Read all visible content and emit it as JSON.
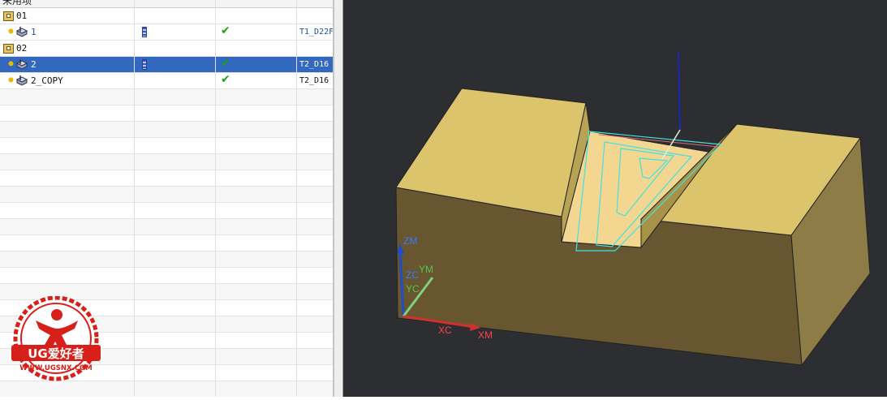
{
  "navigator": {
    "header": "未用项",
    "rows": [
      {
        "name": "01",
        "type": "program",
        "tool": "",
        "has_path": false,
        "checked": false
      },
      {
        "name": "1",
        "type": "operation",
        "tool": "T1_D22F",
        "has_path": true,
        "checked": true
      },
      {
        "name": "02",
        "type": "program",
        "tool": "",
        "has_path": false,
        "checked": false
      },
      {
        "name": "2",
        "type": "operation",
        "tool": "T2_D16",
        "has_path": true,
        "checked": true,
        "selected": true
      },
      {
        "name": "2_COPY",
        "type": "operation",
        "tool": "T2_D16",
        "has_path": false,
        "checked": true
      }
    ]
  },
  "logo": {
    "text": "UG爱好者",
    "url": "WWW.UGSNX.COM",
    "color": "#d8201a"
  },
  "viewport": {
    "background": "#2c2e32",
    "part_color": "#e2c66a",
    "toolpath_color": "#3fe3e3",
    "axes": {
      "zm": "ZM",
      "zc": "ZC",
      "ym": "YM",
      "yc": "YC",
      "xc": "XC",
      "xm": "XM"
    }
  }
}
